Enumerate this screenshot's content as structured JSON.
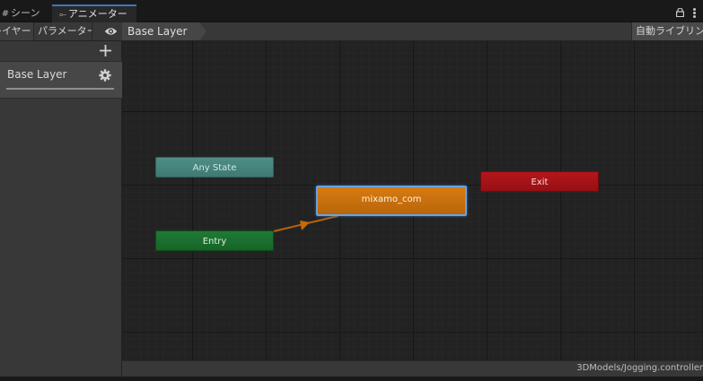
{
  "tabs": {
    "scene": {
      "label": "シーン",
      "icon": "hash-icon"
    },
    "animator": {
      "label": "アニメーター",
      "icon": "animator-icon"
    }
  },
  "toolbar": {
    "layers_label": "レイヤー",
    "parameters_label": "パラメーター",
    "breadcrumb": "Base Layer",
    "auto_live_link": "自動ライブリンク"
  },
  "layers_panel": {
    "layer_name": "Base Layer"
  },
  "graph": {
    "nodes": {
      "any_state": "Any State",
      "entry": "Entry",
      "state": "mixamo_com",
      "exit": "Exit"
    }
  },
  "status": {
    "controller_path": "3DModels/Jogging.controller"
  },
  "colors": {
    "any_state": "#4f8f87",
    "entry": "#207a35",
    "default_state": "#d77b12",
    "exit": "#b5161b",
    "selection": "#6aa3de",
    "transition": "#c46a0a"
  }
}
